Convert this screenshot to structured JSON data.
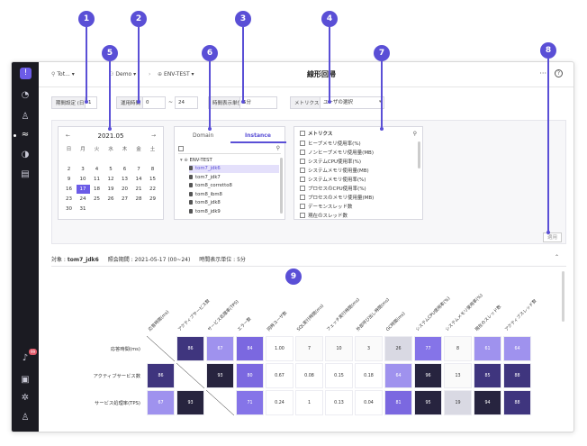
{
  "callouts": [
    "1",
    "2",
    "3",
    "4",
    "5",
    "6",
    "7",
    "8",
    "9"
  ],
  "breadcrumb": {
    "item1": "Tot...",
    "item2": "Demo",
    "item3": "ENV-TEST"
  },
  "page_title": "線形回帰",
  "topbar": {
    "more": "···",
    "help": "?"
  },
  "filters": {
    "period_label": "期間設定 (日)",
    "period_value": "1",
    "op_time_label": "運用時間",
    "op_start": "0",
    "op_sep": "~",
    "op_end": "24",
    "unit_label": "時間表示単位",
    "unit_value": "5分",
    "metrics_label": "メトリクス",
    "metrics_value": "ユーザの選択"
  },
  "calendar": {
    "month": "2021.05",
    "prev": "←",
    "next": "→",
    "dow": [
      "日",
      "月",
      "火",
      "水",
      "木",
      "金",
      "土"
    ],
    "weeks": [
      [
        "",
        "",
        "",
        "",
        "",
        "",
        ""
      ],
      [
        "2",
        "3",
        "4",
        "5",
        "6",
        "7",
        "8"
      ],
      [
        "9",
        "10",
        "11",
        "12",
        "13",
        "14",
        "15"
      ],
      [
        "16",
        "17",
        "18",
        "19",
        "20",
        "21",
        "22"
      ],
      [
        "23",
        "24",
        "25",
        "26",
        "27",
        "28",
        "29"
      ],
      [
        "30",
        "31",
        "",
        "",
        "",
        "",
        ""
      ]
    ],
    "selected": "17"
  },
  "tabs": {
    "domain": "Domain",
    "instance": "Instance"
  },
  "tree": {
    "root": "ENV-TEST",
    "items": [
      "tom7_jdk6",
      "tom7_jdk7",
      "tom8_corretto8",
      "tom8_ibm8",
      "tom8_jdk8",
      "tom8_jdk9"
    ],
    "selected": "tom7_jdk6"
  },
  "metrics": {
    "header": "メトリクス",
    "items": [
      "ヒープメモリ使用率(%)",
      "ノンヒープメモリ使用量(MB)",
      "システムCPU使用率(%)",
      "システムメモリ使用量(MB)",
      "システムメモリ使用率(%)",
      "プロセスのCPU使用率(%)",
      "プロセスのメモリ使用量(MB)",
      "デーモンスレッド数",
      "現在のスレッド数"
    ]
  },
  "apply_button": "適用",
  "info": {
    "target_label": "対象 : ",
    "target_value": "tom7_jdk6",
    "period_label": "照会期間 : ",
    "period_value": "2021-05-17 (00~24)",
    "unit_label": "時間表示単位 : ",
    "unit_value": "5分"
  },
  "heatmap": {
    "columns": [
      "応答時間(ms)",
      "アクティブサービス数",
      "サービス処理率(TPS)",
      "エラー数",
      "同時ユーザ数",
      "SQL実行時間(ms)",
      "フェッチ実行時間(ms)",
      "外部呼び出し時間(ms)",
      "GC時間(ms)",
      "システムCPU使用率(%)",
      "システムメモリ使用率(%)",
      "現在のスレッド数",
      "アクティブスレッド数"
    ],
    "rows": [
      {
        "label": "応答時間(ms)",
        "values": [
          "",
          "86",
          "67",
          "84",
          "1.00",
          "7",
          "10",
          "3",
          "26",
          "77",
          "8",
          "61",
          "64"
        ]
      },
      {
        "label": "アクティブサービス数",
        "values": [
          "86",
          "",
          "93",
          "80",
          "0.67",
          "0.08",
          "0.15",
          "0.18",
          "64",
          "96",
          "13",
          "85",
          "88"
        ]
      },
      {
        "label": "サービス処理率(TPS)",
        "values": [
          "67",
          "93",
          "",
          "71",
          "0.24",
          "1",
          "0.13",
          "0.04",
          "81",
          "95",
          "19",
          "94",
          "88"
        ]
      }
    ]
  }
}
